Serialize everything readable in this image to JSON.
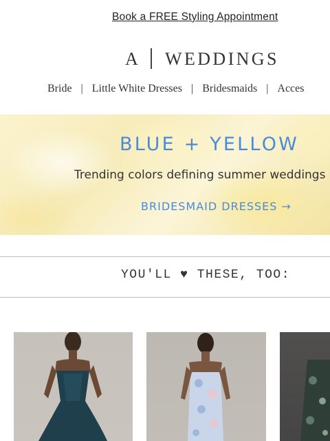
{
  "promo": {
    "link": "Book a FREE Styling Appointment"
  },
  "logo": {
    "mark": "A",
    "word": "WEDDINGS"
  },
  "nav": {
    "items": [
      {
        "label": "Bride"
      },
      {
        "label": "Little White Dresses"
      },
      {
        "label": "Bridesmaids"
      },
      {
        "label": "Acces"
      }
    ],
    "separator": "|"
  },
  "hero": {
    "title": "BLUE + YELLOW",
    "subtitle": "Trending colors defining summer weddings",
    "cta": "BRIDESMAID DRESSES",
    "cta_arrow": "→",
    "accent_color": "#4a8ad8"
  },
  "section": {
    "title": "YOU'LL ♥ THESE, TOO:"
  },
  "products": [
    {
      "image": "model-in-dark-teal-satin-slip-gown"
    },
    {
      "image": "model-in-light-blue-floral-midi-dress"
    },
    {
      "image": "model-in-dark-green-floral-gown"
    }
  ]
}
